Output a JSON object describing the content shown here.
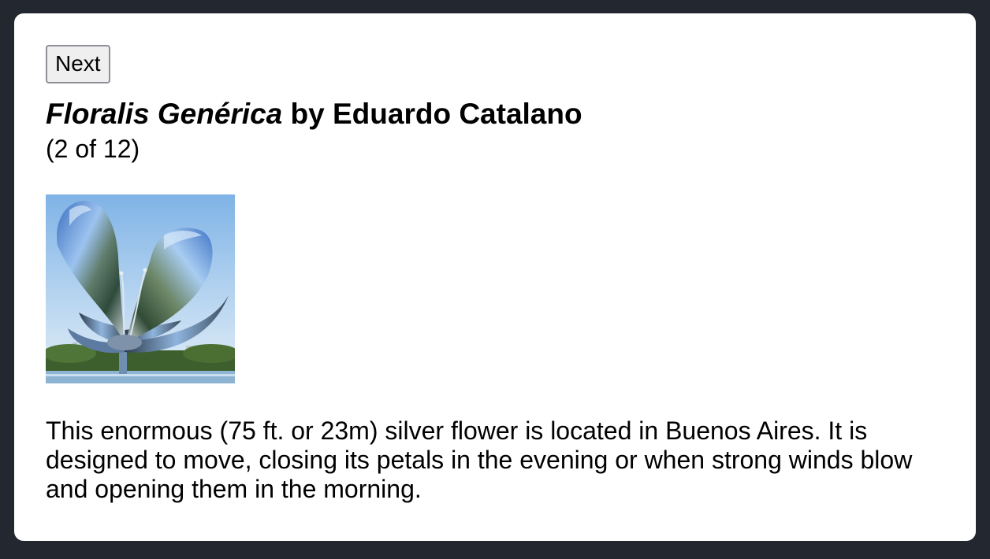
{
  "gallery": {
    "next_label": "Next",
    "artwork_title": "Floralis Genérica",
    "artist_byline": "by Eduardo Catalano",
    "counter": "(2 of 12)",
    "image_subject": "metallic-flower-sculpture",
    "description": "This enormous (75 ft. or 23m) silver flower is located in Buenos Aires. It is designed to move, closing its petals in the evening or when strong winds blow and opening them in the morning."
  },
  "colors": {
    "page_background": "#23272f",
    "card_background": "#ffffff",
    "button_background": "#efefef",
    "button_border": "#8f8f98"
  }
}
